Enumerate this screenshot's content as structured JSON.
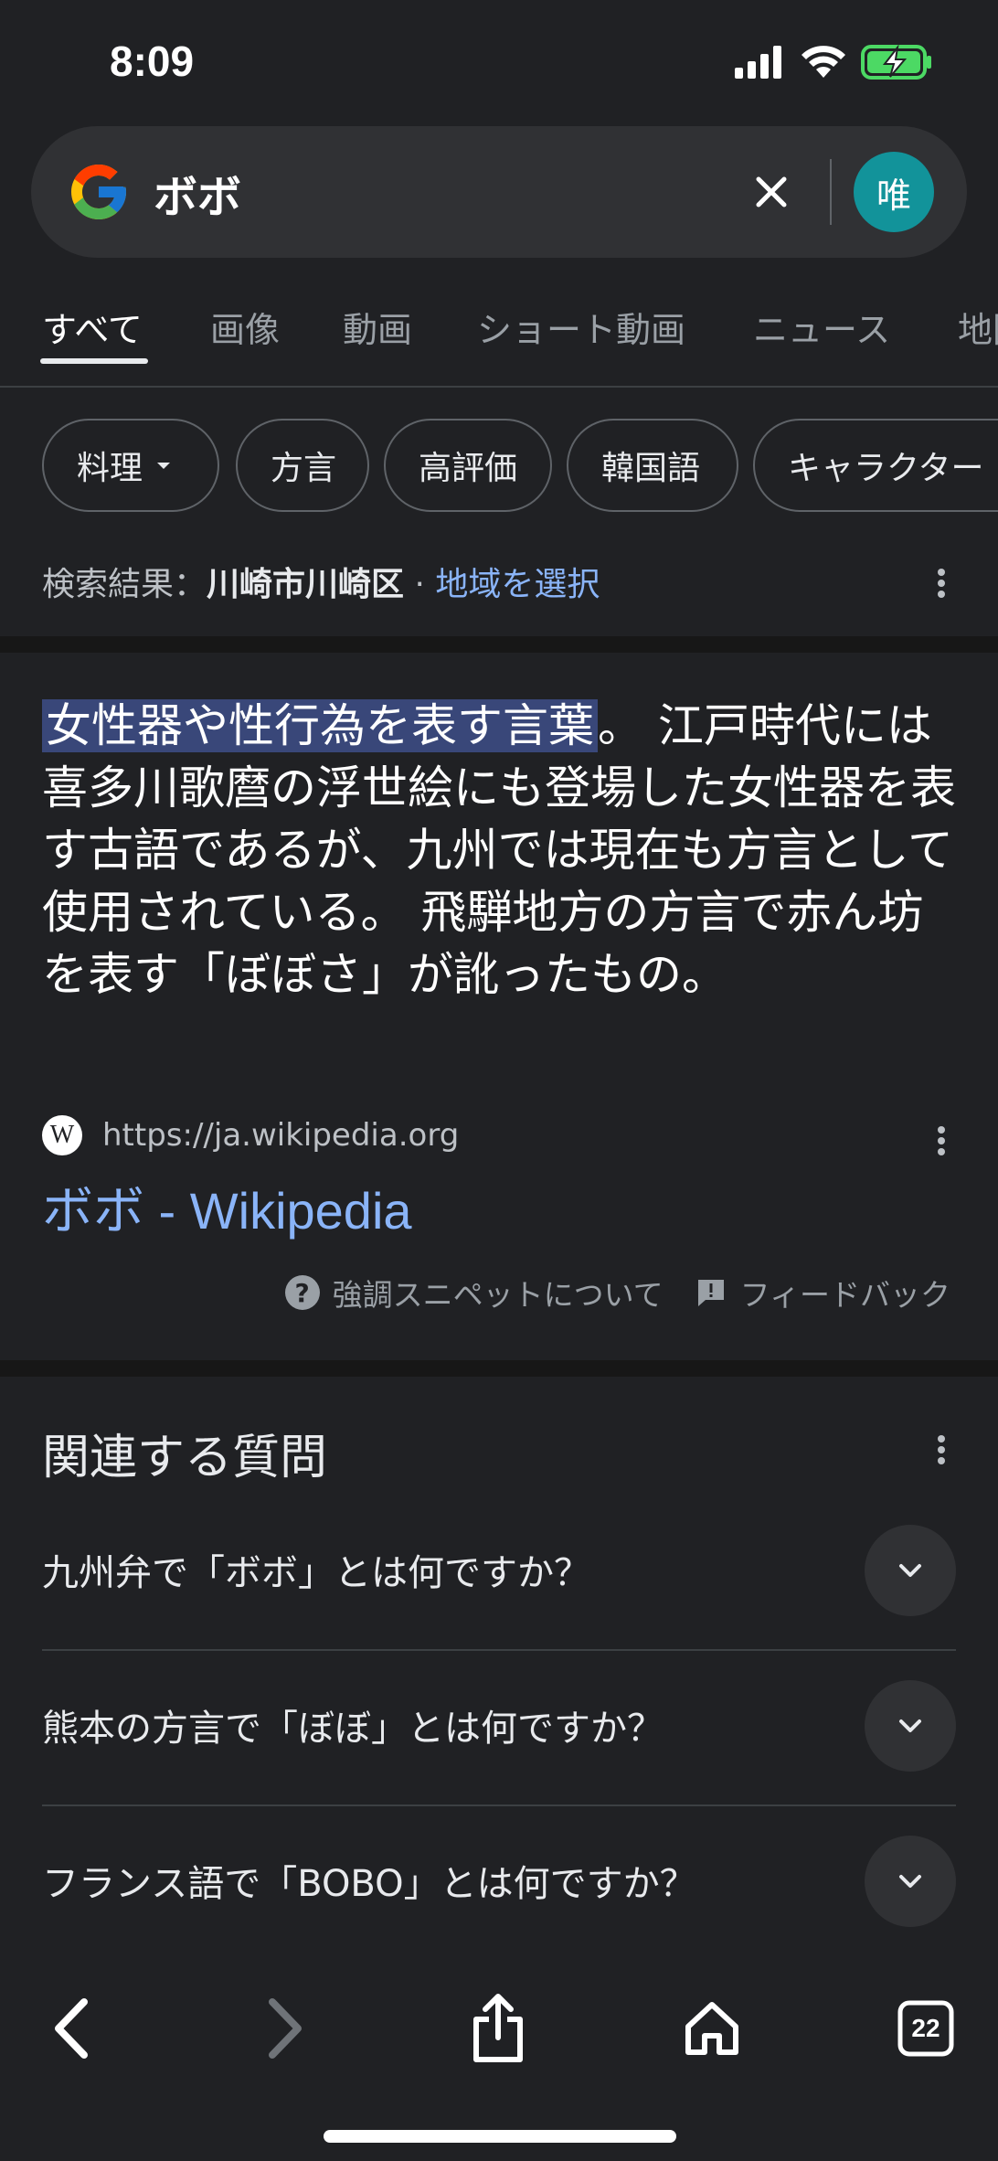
{
  "status_bar": {
    "time": "8:09"
  },
  "search": {
    "query": "ボボ",
    "avatar_initial": "唯"
  },
  "tabs": [
    "すべて",
    "画像",
    "動画",
    "ショート動画",
    "ニュース",
    "地图"
  ],
  "chips": [
    "料理",
    "方言",
    "高評価",
    "韓国語",
    "キャラクター"
  ],
  "location": {
    "prefix": "検索結果：",
    "place": "川崎市川崎区",
    "separator": " · ",
    "link": "地域を選択"
  },
  "snippet": {
    "highlight": "女性器や性行為を表す言葉",
    "text": "。 江戸時代には喜多川歌麿の浮世絵にも登場した女性器を表す古語であるが、九州では現在も方言として使用されている。 飛騨地方の方言で赤ん坊を表す「ぼぼさ」が訛ったもの。"
  },
  "source": {
    "favicon": "W",
    "url": "https://ja.wikipedia.org",
    "title": "ボボ - Wikipedia"
  },
  "feedback": {
    "about_snippet": "強調スニペットについて",
    "feedback": "フィードバック"
  },
  "related_questions": {
    "title": "関連する質問",
    "items": [
      "九州弁で「ボボ」とは何ですか？",
      "熊本の方言で「ぼぼ」とは何ですか？",
      "フランス語で「BOBO」とは何ですか？"
    ]
  },
  "bottom_bar": {
    "tab_count": "22"
  },
  "colors": {
    "background": "#202124",
    "link": "#8ab4f8",
    "highlight": "#394779",
    "avatar": "#12939a"
  }
}
